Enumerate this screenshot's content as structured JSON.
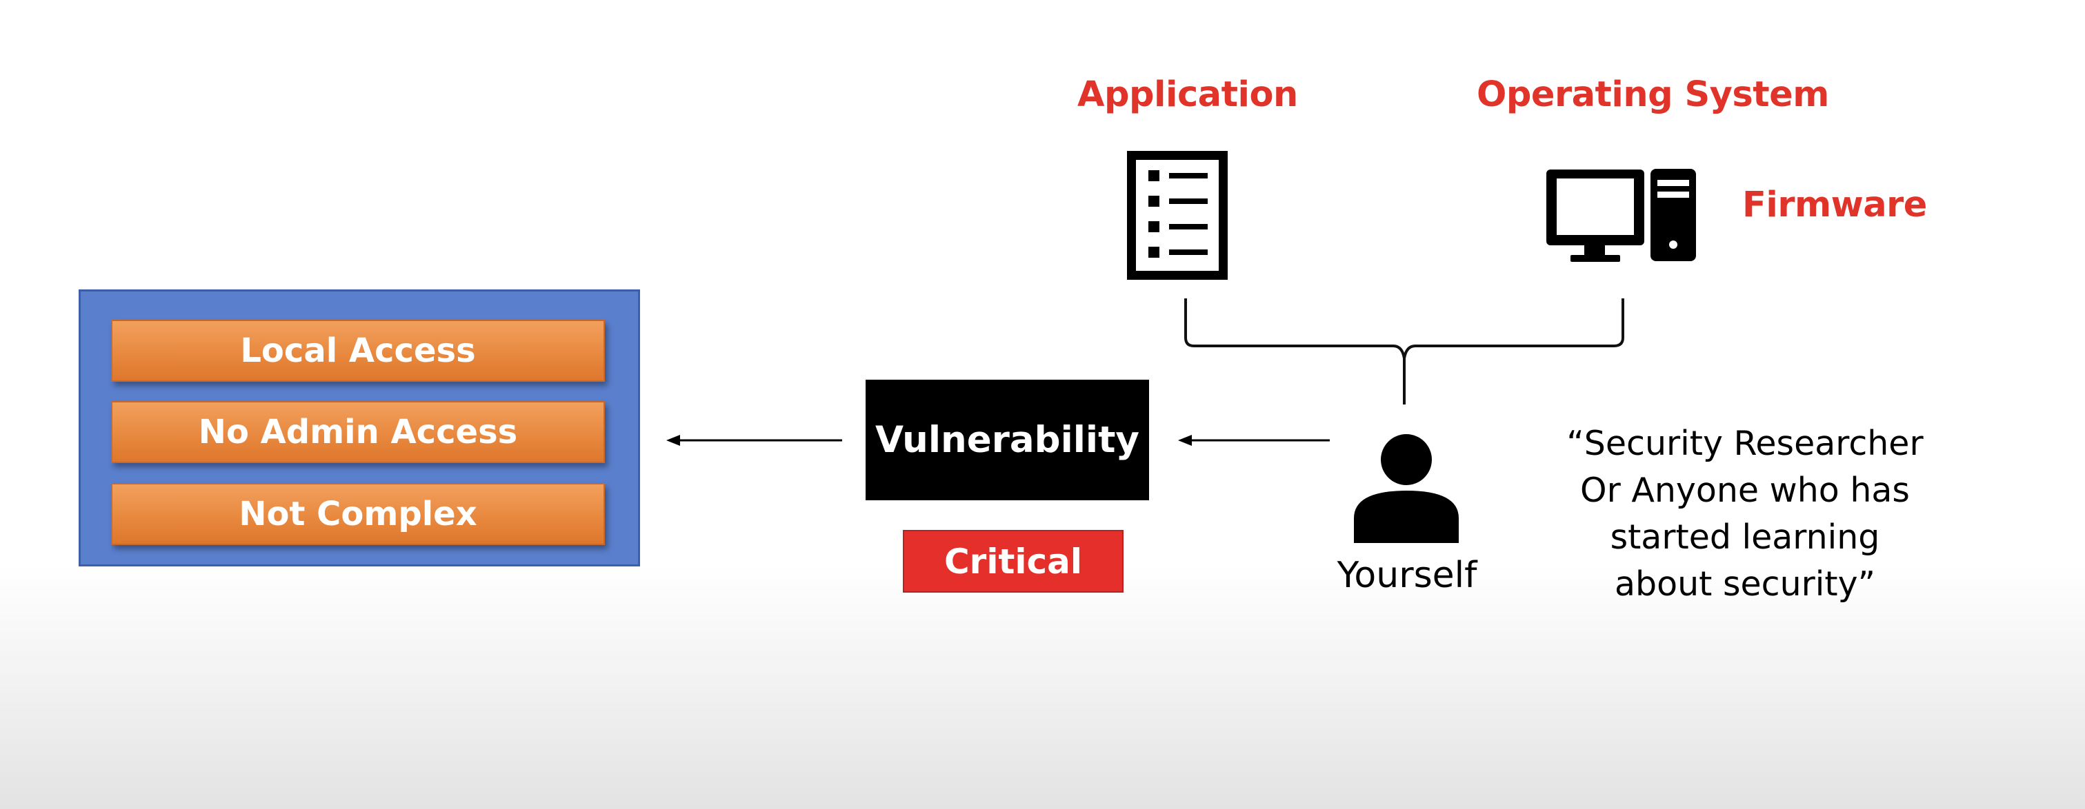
{
  "labels": {
    "application": "Application",
    "operating_system": "Operating System",
    "firmware": "Firmware"
  },
  "conditions": [
    "Local Access",
    "No Admin Access",
    "Not Complex"
  ],
  "vulnerability": "Vulnerability",
  "severity": "Critical",
  "actor": "Yourself",
  "quote_lines": [
    "“Security Researcher",
    "Or Anyone who has",
    "started learning",
    "about security”"
  ],
  "icons": {
    "application": "document-list-icon",
    "operating_system": "desktop-computer-icon",
    "actor": "person-icon"
  },
  "colors": {
    "red_label": "#e0342a",
    "box_blue": "#5a7fcd",
    "condition_orange": "#e8893f",
    "critical_red": "#e42f2a",
    "vulnerability_bg": "#000000"
  }
}
